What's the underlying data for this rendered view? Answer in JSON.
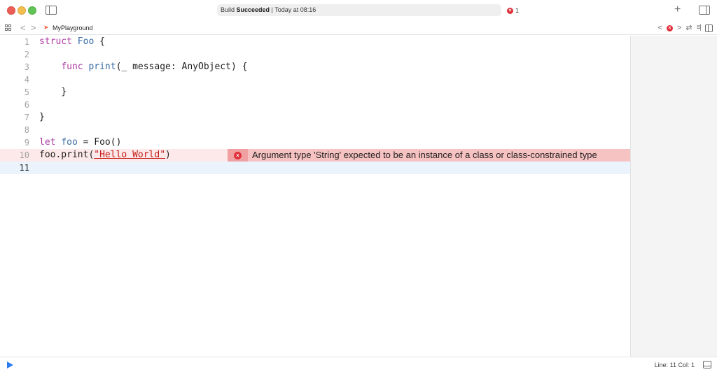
{
  "titlebar": {
    "activity_prefix": "Build ",
    "activity_status": "Succeeded",
    "activity_suffix": " | Today at 08:16",
    "issue_count": "1",
    "add_symbol": "+"
  },
  "jumpbar": {
    "breadcrumb": "MyPlayground",
    "back_symbol": "<",
    "forward_symbol": ">"
  },
  "editor": {
    "lines": [
      {
        "num": "1"
      },
      {
        "num": "2"
      },
      {
        "num": "3"
      },
      {
        "num": "4"
      },
      {
        "num": "5"
      },
      {
        "num": "6"
      },
      {
        "num": "7"
      },
      {
        "num": "8"
      },
      {
        "num": "9"
      },
      {
        "num": "10"
      },
      {
        "num": "11"
      }
    ],
    "tokens": {
      "struct_kw": "struct",
      "foo_type": "Foo",
      "open_brace": " {",
      "func_kw": "func",
      "print_name": "print",
      "print_params": "(_ message: AnyObject) {",
      "close_brace_inner": "}",
      "close_brace_outer": "}",
      "let_kw": "let",
      "foo_var": "foo",
      "let_rest": " = Foo()",
      "call_prefix": "foo.print(",
      "call_string": "\"Hello World\"",
      "call_suffix": ")"
    },
    "error": {
      "message": "Argument type 'String' expected to be an instance of a class or class-constrained type",
      "icon_glyph": "×"
    }
  },
  "statusbar": {
    "position": "Line: 11  Col: 1"
  },
  "colors": {
    "keyword": "#ad3da4",
    "type": "#3a6ea5",
    "string": "#c41a16",
    "error": "#e0303a",
    "run": "#2a7cf0"
  },
  "icons": [
    "close-window-icon",
    "minimize-window-icon",
    "zoom-window-icon",
    "sidebar-toggle-icon",
    "error-icon",
    "add-icon",
    "inspector-toggle-icon",
    "grid-icon",
    "chevron-left-icon",
    "chevron-right-icon",
    "swift-icon",
    "swap-icon",
    "lines-icon",
    "canvas-toggle-icon",
    "run-icon",
    "console-toggle-icon"
  ]
}
